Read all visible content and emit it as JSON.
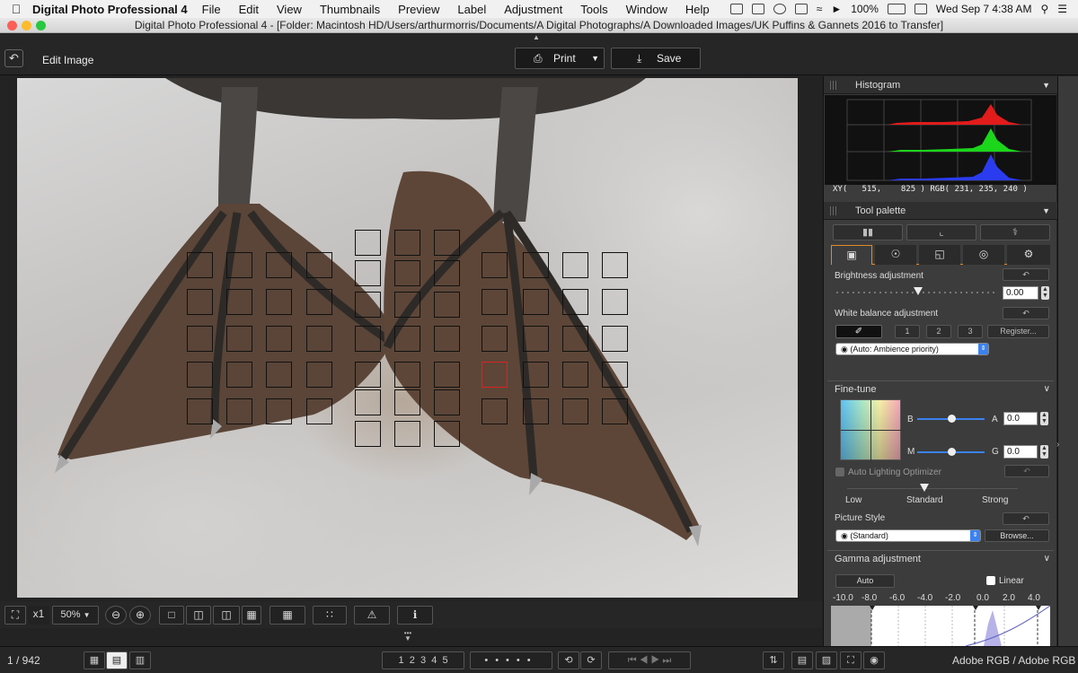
{
  "menubar": {
    "app_name": "Digital Photo Professional 4",
    "items": [
      "File",
      "Edit",
      "View",
      "Thumbnails",
      "Preview",
      "Label",
      "Adjustment",
      "Tools",
      "Window",
      "Help"
    ],
    "battery": "100%",
    "datetime": "Wed Sep 7  4:38 AM"
  },
  "window": {
    "title": "Digital Photo Professional 4 - [Folder: Macintosh HD/Users/arthurmorris/Documents/A Digital Photographs/A Downloaded Images/UK Puffins & Gannets 2016 to Transfer]"
  },
  "toolbar": {
    "edit_title": "Edit Image",
    "print_label": "Print",
    "save_label": "Save"
  },
  "histogram": {
    "header": "Histogram",
    "readout": "XY(   515,    825 ) RGB( 231, 235, 240 )"
  },
  "tool_palette": {
    "header": "Tool palette",
    "brightness": {
      "label": "Brightness adjustment",
      "value": "0.00"
    },
    "white_balance": {
      "label": "White balance adjustment",
      "presets": [
        "1",
        "2",
        "3"
      ],
      "register_label": "Register...",
      "selected": "(Auto: Ambience priority)"
    }
  },
  "fine_tune": {
    "header": "Fine-tune",
    "b_label": "B",
    "a_label": "A",
    "a_value": "0.0",
    "m_label": "M",
    "g_label": "G",
    "g_value": "0.0",
    "alo_label": "Auto Lighting Optimizer",
    "alo_levels": [
      "Low",
      "Standard",
      "Strong"
    ],
    "picture_style_label": "Picture Style",
    "picture_style_value": "(Standard)",
    "browse_label": "Browse..."
  },
  "gamma": {
    "header": "Gamma adjustment",
    "auto_label": "Auto",
    "linear_label": "Linear",
    "ticks": [
      "-10.0",
      "-8.0",
      "-6.0",
      "-4.0",
      "-2.0",
      "0.0",
      "2.0",
      "4.0"
    ]
  },
  "viewbar": {
    "zoom_multiplier": "x1",
    "zoom_level": "50%"
  },
  "statusbar": {
    "image_count": "1 / 942",
    "ratings": [
      "1",
      "2",
      "3",
      "4",
      "5"
    ],
    "color_space": "Adobe RGB / Adobe RGB"
  },
  "colors": {
    "accent_blue": "#3b82f0",
    "selected_af_point": "#dd2222",
    "histogram_red": "#e21b1b",
    "histogram_green": "#1bd61b",
    "histogram_blue": "#2b3cf0"
  }
}
